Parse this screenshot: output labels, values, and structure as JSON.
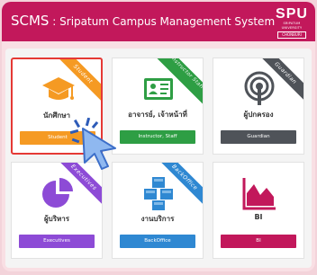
{
  "header": {
    "app_name": "SCMS",
    "separator": " : ",
    "subtitle": "Sripatum Campus Management System",
    "logo": {
      "line1": "SPU",
      "line2": "SRIPATUM UNIVERSITY",
      "line3": "CHONBURI"
    }
  },
  "cards": [
    {
      "label": "นักศึกษา",
      "button": "Student",
      "ribbon": "Student",
      "icon": "graduation-cap-icon",
      "color": "#f59a23",
      "selected": true
    },
    {
      "label": "อาจารย์, เจ้าหน้าที่",
      "button": "Instructor, Staff",
      "ribbon": "Instructor Staff",
      "icon": "id-card-icon",
      "color": "#2e9e44",
      "selected": false
    },
    {
      "label": "ผู้ปกครอง",
      "button": "Guardian",
      "ribbon": "Guardian",
      "icon": "guardian-broadcast-icon",
      "color": "#4f5359",
      "selected": false
    },
    {
      "label": "ผู้บริหาร",
      "button": "Executives",
      "ribbon": "Executives",
      "icon": "pie-chart-icon",
      "color": "#8d4bd6",
      "selected": false
    },
    {
      "label": "งานบริการ",
      "button": "BackOffice",
      "ribbon": "BackOffice",
      "icon": "boxes-icon",
      "color": "#2f88d2",
      "selected": false
    },
    {
      "label": "BI",
      "button": "BI",
      "ribbon": "",
      "icon": "area-chart-icon",
      "color": "#c2185b",
      "selected": false
    }
  ]
}
